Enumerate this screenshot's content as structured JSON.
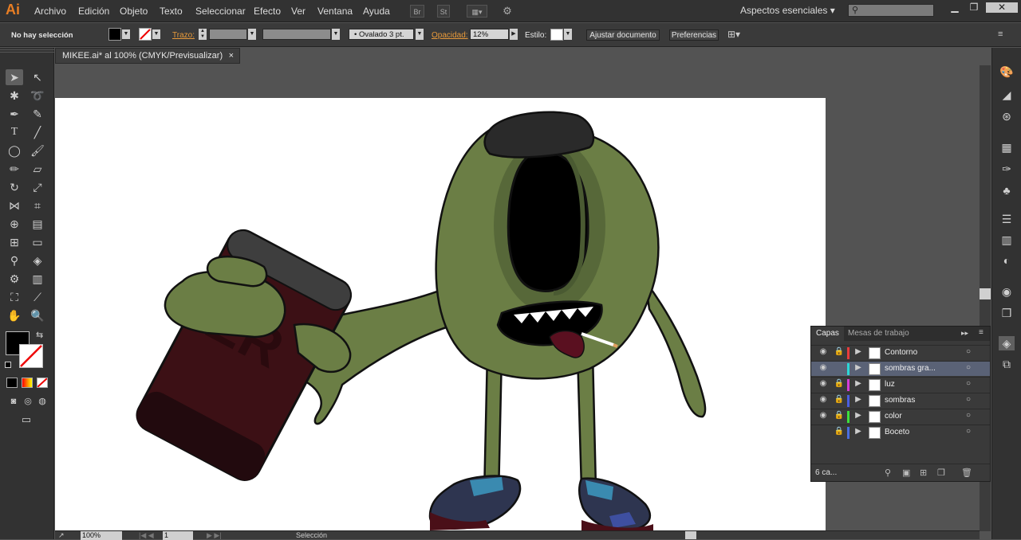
{
  "app": {
    "logo": "Ai"
  },
  "menu": [
    "Archivo",
    "Edición",
    "Objeto",
    "Texto",
    "Seleccionar",
    "Efecto",
    "Ver",
    "Ventana",
    "Ayuda"
  ],
  "menubar_buttons": {
    "bridge": "Br",
    "stock": "St"
  },
  "workspace": {
    "label": "Aspectos esenciales"
  },
  "control": {
    "selection_status": "No hay selección",
    "stroke_label": "Trazo:",
    "brush_label": "Ovalado 3 pt.",
    "opacity_label": "Opacidad:",
    "opacity_value": "12%",
    "style_label": "Estilo:",
    "ajustar": "Ajustar documento",
    "preferencias": "Preferencias"
  },
  "document": {
    "tab_title": "MIKEE.ai* al 100% (CMYK/Previsualizar)",
    "close": "×"
  },
  "layers_panel": {
    "tabs": [
      "Capas",
      "Mesas de trabajo"
    ],
    "layers": [
      {
        "name": "Contorno",
        "color": "#e83c3c",
        "visible": true,
        "locked": true,
        "selected": false
      },
      {
        "name": "sombras gra...",
        "color": "#2cd6d6",
        "visible": true,
        "locked": false,
        "selected": true
      },
      {
        "name": "luz",
        "color": "#d63cd6",
        "visible": true,
        "locked": true,
        "selected": false
      },
      {
        "name": "sombras",
        "color": "#4a5ee0",
        "visible": true,
        "locked": true,
        "selected": false
      },
      {
        "name": "color",
        "color": "#3ce03c",
        "visible": true,
        "locked": true,
        "selected": false
      },
      {
        "name": "Boceto",
        "color": "#4a6ee0",
        "visible": false,
        "locked": true,
        "selected": false
      }
    ],
    "count": "6 ca..."
  },
  "status": {
    "zoom": "100%",
    "artboard": "1",
    "tool": "Selección"
  },
  "colors": {
    "accent": "#e87e24",
    "body_green": "#6b7e45",
    "can_maroon": "#3c1015"
  }
}
